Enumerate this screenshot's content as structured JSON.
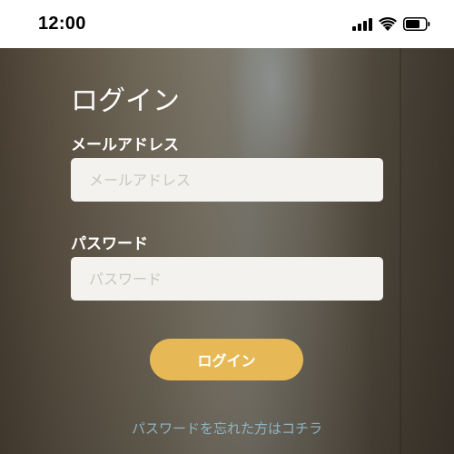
{
  "status_bar": {
    "time": "12:00",
    "icons": [
      "signal-icon",
      "wifi-icon",
      "battery-icon"
    ]
  },
  "login": {
    "title": "ログイン",
    "email_label": "メールアドレス",
    "email_placeholder": "メールアドレス",
    "email_value": "",
    "password_label": "パスワード",
    "password_placeholder": "パスワード",
    "password_value": "",
    "button_label": "ログイン",
    "forgot_link": "パスワードを忘れた方はコチラ"
  },
  "colors": {
    "button": "#e6b956",
    "link": "#8fb3c2",
    "input_bg": "#f4f2ee"
  }
}
